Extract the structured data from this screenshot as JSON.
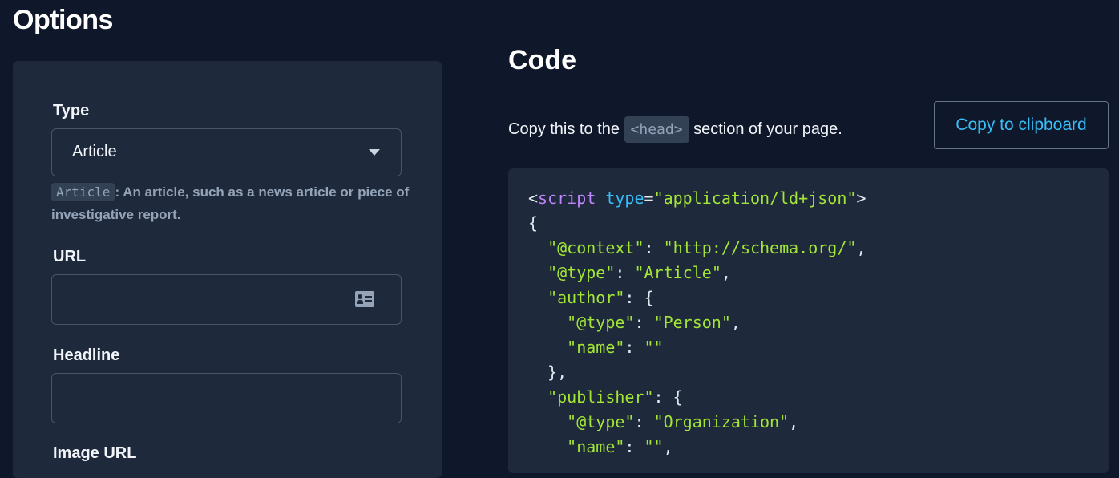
{
  "options": {
    "title": "Options",
    "type_label": "Type",
    "type_value": "Article",
    "type_hint_code": "Article",
    "type_hint_text": ": An article, such as a news article or piece of investigative report.",
    "url_label": "URL",
    "url_value": "",
    "headline_label": "Headline",
    "headline_value": "",
    "image_url_label": "Image URL"
  },
  "code": {
    "title": "Code",
    "note_prefix": "Copy this to the ",
    "note_code": "<head>",
    "note_suffix": " section of your page.",
    "copy_button": "Copy to clipboard",
    "lines": [
      [
        {
          "t": "<",
          "c": "p"
        },
        {
          "t": "script",
          "c": "tag"
        },
        {
          "t": " ",
          "c": "p"
        },
        {
          "t": "type",
          "c": "attr"
        },
        {
          "t": "=",
          "c": "p"
        },
        {
          "t": "\"application/ld+json\"",
          "c": "str"
        },
        {
          "t": ">",
          "c": "p"
        }
      ],
      [
        {
          "t": "{",
          "c": "p"
        }
      ],
      [
        {
          "t": "  ",
          "c": "p"
        },
        {
          "t": "\"@context\"",
          "c": "str"
        },
        {
          "t": ": ",
          "c": "p"
        },
        {
          "t": "\"http://schema.org/\"",
          "c": "str"
        },
        {
          "t": ",",
          "c": "p"
        }
      ],
      [
        {
          "t": "  ",
          "c": "p"
        },
        {
          "t": "\"@type\"",
          "c": "str"
        },
        {
          "t": ": ",
          "c": "p"
        },
        {
          "t": "\"Article\"",
          "c": "str"
        },
        {
          "t": ",",
          "c": "p"
        }
      ],
      [
        {
          "t": "  ",
          "c": "p"
        },
        {
          "t": "\"author\"",
          "c": "str"
        },
        {
          "t": ": {",
          "c": "p"
        }
      ],
      [
        {
          "t": "    ",
          "c": "p"
        },
        {
          "t": "\"@type\"",
          "c": "str"
        },
        {
          "t": ": ",
          "c": "p"
        },
        {
          "t": "\"Person\"",
          "c": "str"
        },
        {
          "t": ",",
          "c": "p"
        }
      ],
      [
        {
          "t": "    ",
          "c": "p"
        },
        {
          "t": "\"name\"",
          "c": "str"
        },
        {
          "t": ": ",
          "c": "p"
        },
        {
          "t": "\"\"",
          "c": "str"
        }
      ],
      [
        {
          "t": "  },",
          "c": "p"
        }
      ],
      [
        {
          "t": "  ",
          "c": "p"
        },
        {
          "t": "\"publisher\"",
          "c": "str"
        },
        {
          "t": ": {",
          "c": "p"
        }
      ],
      [
        {
          "t": "    ",
          "c": "p"
        },
        {
          "t": "\"@type\"",
          "c": "str"
        },
        {
          "t": ": ",
          "c": "p"
        },
        {
          "t": "\"Organization\"",
          "c": "str"
        },
        {
          "t": ",",
          "c": "p"
        }
      ],
      [
        {
          "t": "    ",
          "c": "p"
        },
        {
          "t": "\"name\"",
          "c": "str"
        },
        {
          "t": ": ",
          "c": "p"
        },
        {
          "t": "\"\"",
          "c": "str"
        },
        {
          "t": ",",
          "c": "p"
        }
      ]
    ]
  },
  "colors": {
    "background": "#0f172a",
    "panel": "#1e293b",
    "accent": "#38bdf8",
    "tag": "#c084fc",
    "string": "#a3e635"
  },
  "icons": {
    "select_caret": "caret-down-icon",
    "url_field": "id-card-icon"
  }
}
